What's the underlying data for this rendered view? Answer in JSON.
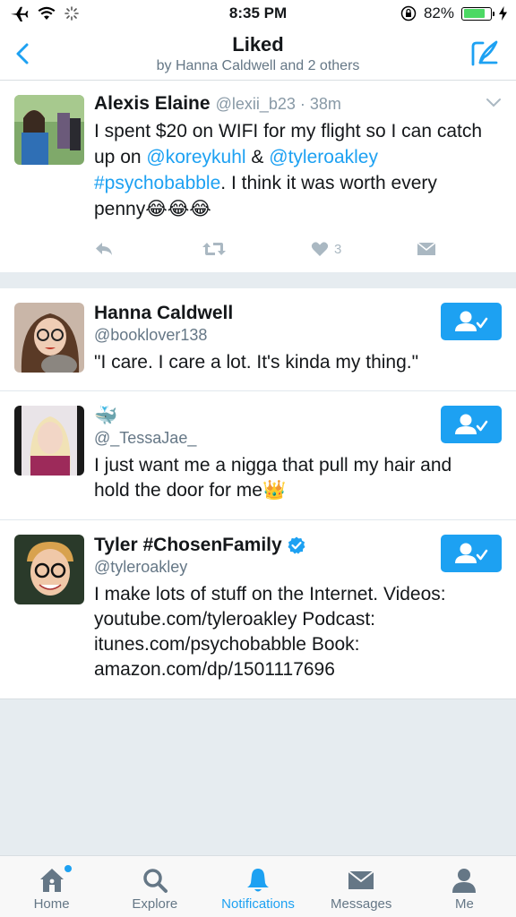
{
  "status_bar": {
    "time": "8:35 PM",
    "battery": "82%",
    "battery_level": 0.82
  },
  "header": {
    "title": "Liked",
    "subtitle": "by Hanna Caldwell and 2 others"
  },
  "tweet": {
    "name": "Alexis Elaine",
    "handle": "@lexii_b23",
    "separator": " · ",
    "time": "38m",
    "text_1": "I spent $20 on WIFI for my flight so I can catch up on ",
    "mention_1": "@koreykuhl",
    "text_2": " & ",
    "mention_2": "@tyleroakley",
    "text_3": " ",
    "hashtag": "#psychobabble",
    "text_4": ". I think it was worth every penny",
    "emoji": "😂😂😂",
    "like_count": "3"
  },
  "users": [
    {
      "name": "Hanna Caldwell",
      "handle": "@booklover138",
      "bio": "\"I care. I care a lot. It's kinda my thing.\""
    },
    {
      "name": "🐳",
      "handle": "@_TessaJae_",
      "bio": "I just want me a nigga that pull my hair and hold the door for me👑"
    },
    {
      "name": "Tyler #ChosenFamily",
      "handle": "@tyleroakley",
      "bio": "I make lots of stuff on the Internet. Videos: youtube.com/tyleroakley Podcast: itunes.com/psychobabble Book: amazon.com/dp/1501117696",
      "verified": true
    }
  ],
  "tabs": [
    {
      "label": "Home",
      "icon": "home-icon"
    },
    {
      "label": "Explore",
      "icon": "search-icon"
    },
    {
      "label": "Notifications",
      "icon": "bell-icon"
    },
    {
      "label": "Messages",
      "icon": "envelope-icon"
    },
    {
      "label": "Me",
      "icon": "person-icon"
    }
  ],
  "colors": {
    "accent": "#1da1f2",
    "text": "#14171a",
    "secondary": "#657786"
  }
}
